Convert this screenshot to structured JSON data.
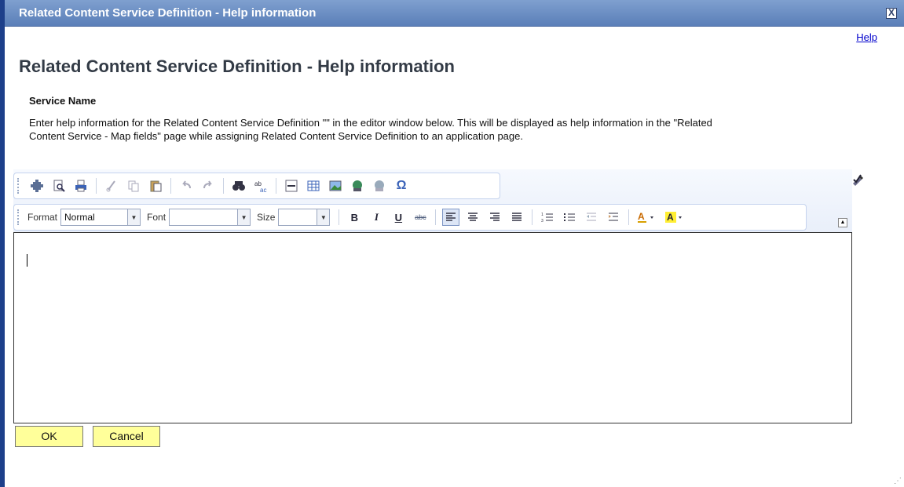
{
  "window": {
    "title": "Related Content Service Definition - Help information",
    "close_label": "X"
  },
  "header": {
    "help_link": "Help",
    "page_title": "Related Content Service Definition - Help information"
  },
  "content": {
    "service_name_label": "Service Name",
    "instructions": "Enter help information for the Related Content Service Definition \"\" in the editor window below. This will be displayed as help information in the \"Related Content Service - Map fields\" page while assigning Related Content Service Definition to an application page."
  },
  "toolbar": {
    "format_label": "Format",
    "format_value": "Normal",
    "font_label": "Font",
    "font_value": "",
    "size_label": "Size",
    "size_value": "",
    "bold": "B",
    "italic": "I",
    "underline": "U",
    "strike": "abc",
    "omega": "Ω"
  },
  "buttons": {
    "ok": "OK",
    "cancel": "Cancel"
  },
  "colors": {
    "titlebar": "#5a7fb8",
    "button_bg": "#ffff9a",
    "link": "#0000cc"
  }
}
